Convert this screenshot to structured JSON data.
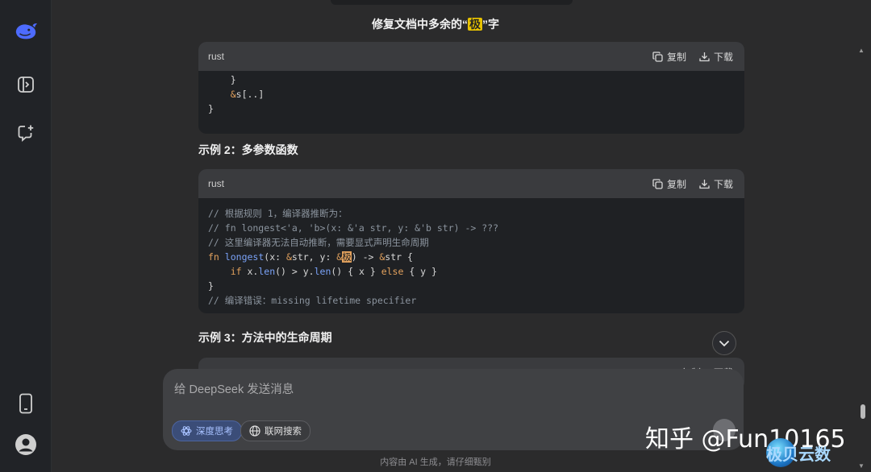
{
  "title_prefix": "修复文档中多余的“",
  "title_highlight": "极",
  "title_suffix": "”字",
  "blocks": [
    {
      "lang": "rust",
      "copy": "复制",
      "download": "下载"
    },
    {
      "lang": "rust",
      "copy": "复制",
      "download": "下载"
    },
    {
      "lang": "",
      "copy": "复制",
      "download": "下载"
    }
  ],
  "code1": {
    "l1": "    }",
    "l2a": "    ",
    "l2amp": "&",
    "l2b": "s[..]",
    "l3": "}"
  },
  "heading2": "示例 2：多参数函数",
  "heading3": "示例 3：方法中的生命周期",
  "code2": {
    "c1": "// 根据规则 1，编译器推断为：",
    "c2": "// fn longest<'a, 'b>(x: &'a str, y: &'b str) -> ???",
    "c3": "// 这里编译器无法自动推断，需要显式声明生命周期",
    "l4_fn": "fn",
    "l4_name": "longest",
    "l4_a": "(x: ",
    "l4_amp1": "&",
    "l4_b": "str, y: ",
    "l4_amp2": "&",
    "l4_mark": "极",
    "l4_c": ") -> ",
    "l4_amp3": "&",
    "l4_d": "str {",
    "l5_indent": "    ",
    "l5_if": "if",
    "l5_a": " x.",
    "l5_len1": "len",
    "l5_b": "() > y.",
    "l5_len2": "len",
    "l5_c": "() { x } ",
    "l5_else": "else",
    "l5_d": " { y }",
    "l6": "}",
    "c7": "// 编译错误：missing lifetime specifier"
  },
  "composer": {
    "placeholder": "给 DeepSeek 发送消息",
    "deep_think": "深度思考",
    "web_search": "联网搜索"
  },
  "footer_note": "内容由 AI 生成，请仔细甄别",
  "watermark": {
    "zhihu": "知乎 @Fun10165",
    "site": "极贝云数"
  },
  "icons": {
    "logo": "whale-logo-icon",
    "sidebar_toggle": "sidebar-toggle-icon",
    "new_chat": "new-chat-icon",
    "phone": "phone-icon",
    "avatar": "user-avatar-icon"
  },
  "colors": {
    "accent": "#4d6bfe",
    "sidebar_bg": "#212327",
    "page_bg": "#2b2b2c",
    "code_bg": "#1f2124",
    "code_head_bg": "#3a3b3e",
    "highlight": "#e7c200"
  }
}
